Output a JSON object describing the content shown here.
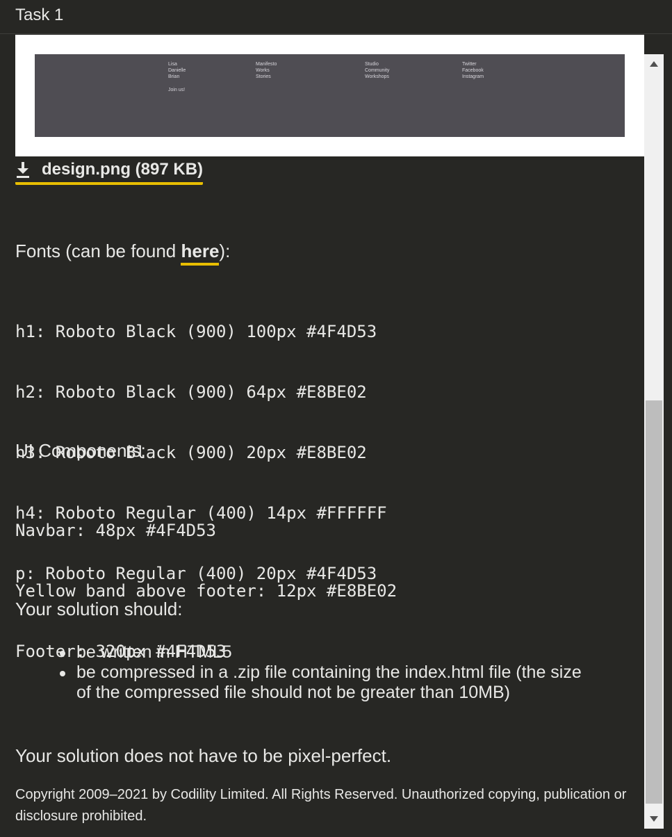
{
  "header": {
    "title": "Task 1"
  },
  "preview": {
    "columns": [
      {
        "items": [
          "Lisa",
          "Danielle",
          "Brian"
        ],
        "extra": "Join us!"
      },
      {
        "items": [
          "Manifesto",
          "Works",
          "Stories"
        ]
      },
      {
        "items": [
          "Studio",
          "Community",
          "Workshops"
        ]
      },
      {
        "items": [
          "Twitter",
          "Facebook",
          "Instagram"
        ]
      }
    ]
  },
  "download": {
    "icon": "download-icon",
    "label": "design.png (897 KB)"
  },
  "fonts": {
    "title_prefix": "Fonts (can be found ",
    "link_label": "here",
    "title_suffix": "):",
    "lines": [
      "h1: Roboto Black (900) 100px #4F4D53",
      "h2: Roboto Black (900) 64px #E8BE02",
      "h3: Roboto Black (900) 20px #E8BE02",
      "h4: Roboto Regular (400) 14px #FFFFFF",
      "p: Roboto Regular (400) 20px #4F4D53"
    ]
  },
  "components": {
    "title": "UI Components:",
    "lines": [
      "Navbar: 48px #4F4D53",
      "Yellow band above footer: 12px #E8BE02",
      "Footer: 320px #4F4D53"
    ]
  },
  "solution": {
    "title": "Your solution should:",
    "bullets": [
      "be written in HTML5",
      "be compressed in a .zip file containing the index.html file (the size of the compressed file should not be greater than 10MB)"
    ],
    "note": "Your solution does not have to be pixel-perfect."
  },
  "footer": {
    "copyright": "Copyright 2009–2021 by Codility Limited. All Rights Reserved. Unauthorized copying, publication or disclosure prohibited."
  },
  "colors": {
    "accent": "#E8BE02",
    "background": "#272724",
    "footer_gray": "#4F4D53"
  }
}
